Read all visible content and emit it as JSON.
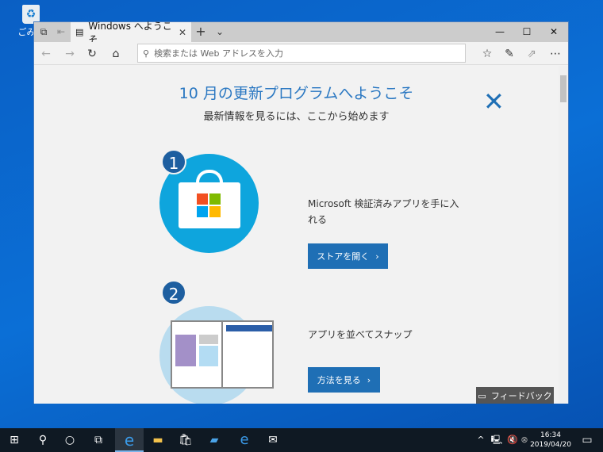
{
  "desktop": {
    "recycle_label": "ごみ箱"
  },
  "browser": {
    "tab_title": "Windows へようこそ",
    "address_placeholder": "検索または Web アドレスを入力"
  },
  "page": {
    "title": "10 月の更新プログラムへようこそ",
    "subtitle": "最新情報を見るには、ここから始めます",
    "steps": [
      {
        "number": "1",
        "text": "Microsoft 検証済みアプリを手に入れる",
        "button": "ストアを開く"
      },
      {
        "number": "2",
        "text": "アプリを並べてスナップ",
        "button": "方法を見る"
      }
    ],
    "feedback": "フィードバック"
  },
  "taskbar": {
    "time": "16:34",
    "date": "2019/04/20"
  },
  "colors": {
    "accent": "#1f6fb5",
    "title": "#2b78c2",
    "store_circle": "#0ea5dd"
  }
}
